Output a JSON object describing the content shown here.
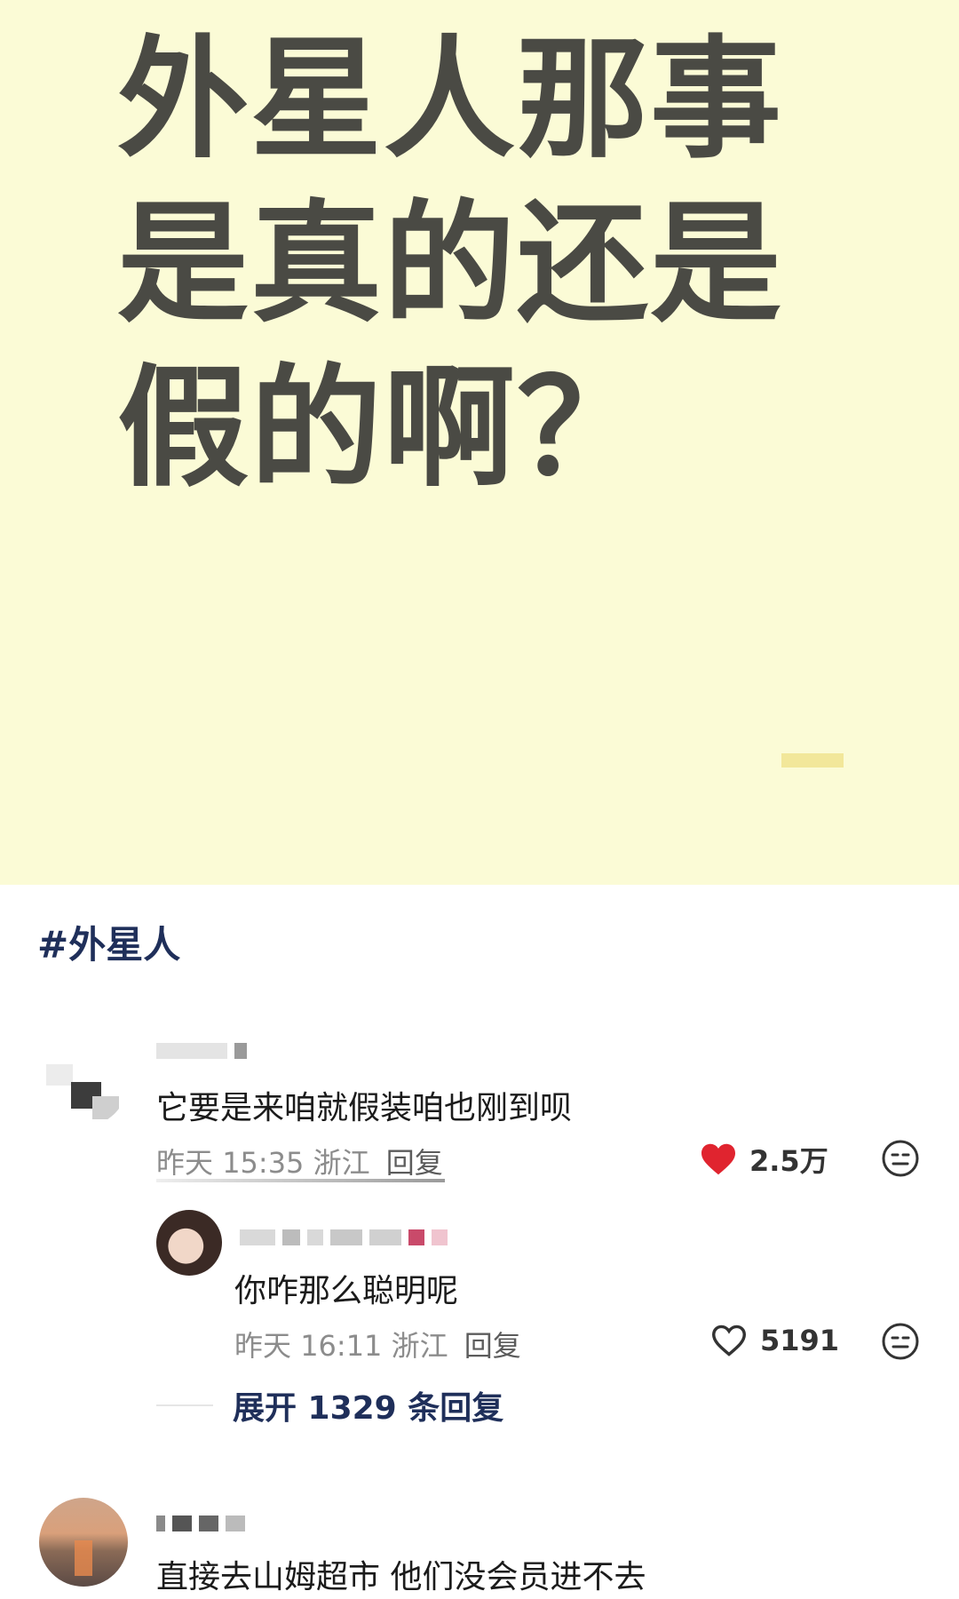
{
  "poster": {
    "title": "外星人那事是真的还是假的啊？"
  },
  "hashtag": "#外星人",
  "comments": [
    {
      "text": "它要是来咱就假装咱也刚到呗",
      "date": "昨天",
      "time": "15:35",
      "location": "浙江",
      "reply_label": "回复",
      "likes": "2.5万",
      "liked": true
    },
    {
      "text": "你咋那么聪明呢",
      "date": "昨天",
      "time": "16:11",
      "location": "浙江",
      "reply_label": "回复",
      "likes": "5191",
      "liked": false
    },
    {
      "text": "直接去山姆超市 他们没会员进不去"
    }
  ],
  "expand_replies": "展开 1329 条回复",
  "colors": {
    "poster_bg": "#fbfbd6",
    "heart_red": "#e0242f",
    "link_navy": "#1f2f5a"
  },
  "icons": {
    "like_filled": "heart-filled-icon",
    "like_outline": "heart-outline-icon",
    "emoji": "emoji-face-icon"
  }
}
